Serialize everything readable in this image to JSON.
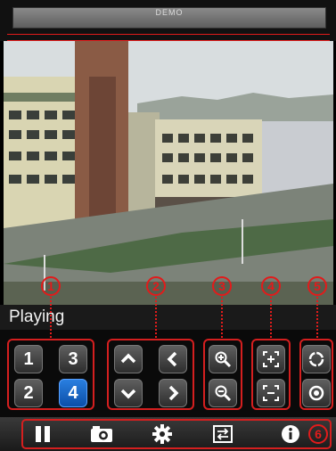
{
  "header": {
    "title": "DEMO"
  },
  "status": {
    "text": "Playing"
  },
  "channels": [
    "1",
    "3",
    "2",
    "4"
  ],
  "active_channel": "4",
  "annotations": [
    "1",
    "2",
    "3",
    "4",
    "5",
    "6"
  ],
  "icons": {
    "ptz": [
      "up-arrow-icon",
      "left-arrow-icon",
      "down-arrow-icon",
      "right-arrow-icon"
    ],
    "zoom": [
      "zoom-in-icon",
      "zoom-out-icon"
    ],
    "focus": [
      "focus-near-icon",
      "focus-far-icon"
    ],
    "iris": [
      "iris-open-icon",
      "iris-close-icon"
    ],
    "toolbar": [
      "pause-icon",
      "snapshot-camera-icon",
      "settings-gear-icon",
      "switch-view-icon",
      "info-icon"
    ]
  },
  "colors": {
    "annotation": "#e21b1b",
    "active_button": "#1a66c9"
  }
}
